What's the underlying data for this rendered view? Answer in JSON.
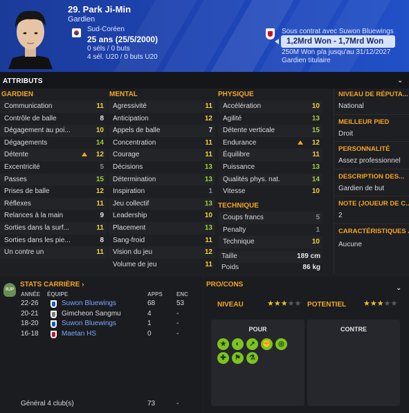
{
  "header": {
    "name": "29. Park Ji-Min",
    "position": "Gardien",
    "nationality": "Sud-Coréen",
    "age": "25 ans (25/5/2000)",
    "caps": "0 séls / 0 buts",
    "u20": "4 sél. U20 / 0 buts U20",
    "contract_label": "Sous contrat avec Suwon Bluewings",
    "value_range": "1,2Mrd Won - 1,7Mrd Won",
    "wage": "250M Won p/a jusqu'au 31/12/2027",
    "squad_status": "Gardien titulaire"
  },
  "attributes_title": "ATTRIBUTS",
  "sections": {
    "gardien": "GARDIEN",
    "mental": "MENTAL",
    "physique": "PHYSIQUE",
    "technique": "TECHNIQUE"
  },
  "gardien": [
    {
      "label": "Communication",
      "value": "11"
    },
    {
      "label": "Contrôle de balle",
      "value": "8"
    },
    {
      "label": "Dégagement au poi...",
      "value": "10"
    },
    {
      "label": "Dégagements",
      "value": "14"
    },
    {
      "label": "Détente",
      "value": "12"
    },
    {
      "label": "Excentricité",
      "value": "5"
    },
    {
      "label": "Passes",
      "value": "15"
    },
    {
      "label": "Prises de balle",
      "value": "12"
    },
    {
      "label": "Réflexes",
      "value": "11"
    },
    {
      "label": "Relances à la main",
      "value": "9"
    },
    {
      "label": "Sorties dans la surf...",
      "value": "11"
    },
    {
      "label": "Sorties dans les pie...",
      "value": "8"
    },
    {
      "label": "Un contre un",
      "value": "11"
    }
  ],
  "mental": [
    {
      "label": "Agressivité",
      "value": "11"
    },
    {
      "label": "Anticipation",
      "value": "12"
    },
    {
      "label": "Appels de balle",
      "value": "7"
    },
    {
      "label": "Concentration",
      "value": "11"
    },
    {
      "label": "Courage",
      "value": "11"
    },
    {
      "label": "Décisions",
      "value": "13"
    },
    {
      "label": "Détermination",
      "value": "13"
    },
    {
      "label": "Inspiration",
      "value": "1"
    },
    {
      "label": "Jeu collectif",
      "value": "13"
    },
    {
      "label": "Leadership",
      "value": "10"
    },
    {
      "label": "Placement",
      "value": "13"
    },
    {
      "label": "Sang-froid",
      "value": "11"
    },
    {
      "label": "Vision du jeu",
      "value": "12"
    },
    {
      "label": "Volume de jeu",
      "value": "11"
    }
  ],
  "physique": [
    {
      "label": "Accélération",
      "value": "10"
    },
    {
      "label": "Agilité",
      "value": "13"
    },
    {
      "label": "Détente verticale",
      "value": "15"
    },
    {
      "label": "Endurance",
      "value": "12"
    },
    {
      "label": "Équilibre",
      "value": "11"
    },
    {
      "label": "Puissance",
      "value": "13"
    },
    {
      "label": "Qualités phys. nat.",
      "value": "14"
    },
    {
      "label": "Vitesse",
      "value": "10"
    }
  ],
  "technique": [
    {
      "label": "Coups francs",
      "value": "5"
    },
    {
      "label": "Penalty",
      "value": "1"
    },
    {
      "label": "Technique",
      "value": "10"
    }
  ],
  "body": {
    "height_label": "Taille",
    "height": "189 cm",
    "weight_label": "Poids",
    "weight": "86 kg"
  },
  "info": {
    "reputation_label": "NIVEAU DE RÉPUTA...",
    "reputation": "National",
    "foot_label": "MEILLEUR PIED",
    "foot": "Droit",
    "personality_label": "PERSONNALITÉ",
    "personality": "Assez professionnel",
    "description_label": "DESCRIPTION DES...",
    "description": "Gardien de but",
    "rating_label": "NOTE (JOUEUR DE C...",
    "rating": "2",
    "traits_label": "CARACTÉRISTIQUES J...",
    "traits": "Aucune"
  },
  "career": {
    "badge": "RJP",
    "title": "STATS CARRIÈRE",
    "col_year": "ANNÉE",
    "col_team": "ÉQUIPE",
    "col_apps": "APPS",
    "col_enc": "ENC",
    "rows": [
      {
        "year": "22-26",
        "team": "Suwon Bluewings",
        "apps": "68",
        "enc": "53"
      },
      {
        "year": "20-21",
        "team": "Gimcheon Sangmu",
        "apps": "4",
        "enc": "-"
      },
      {
        "year": "18-20",
        "team": "Suwon Bluewings",
        "apps": "1",
        "enc": "-"
      },
      {
        "year": "16-18",
        "team": "Maetan HS",
        "apps": "0",
        "enc": "-"
      }
    ],
    "total_label": "Général  4 club(s)",
    "total_apps": "73",
    "total_enc": "-"
  },
  "procons": {
    "title": "PRO/CONS",
    "level_label": "NIVEAU",
    "potential_label": "POTENTIEL",
    "level_stars": 3,
    "potential_stars": 3,
    "pour": "POUR",
    "contre": "CONTRE",
    "pour_icons": [
      "star-icon",
      "heading-icon",
      "trend-up-icon",
      "muscle-icon",
      "target-icon",
      "stamina-icon",
      "flag-icon",
      "potion-icon"
    ]
  },
  "colors": {
    "accent": "#f5a623",
    "header": "#1e46b8",
    "link": "#7fa6ff",
    "good": "#9fd13b",
    "yellow": "#f3d23b"
  }
}
